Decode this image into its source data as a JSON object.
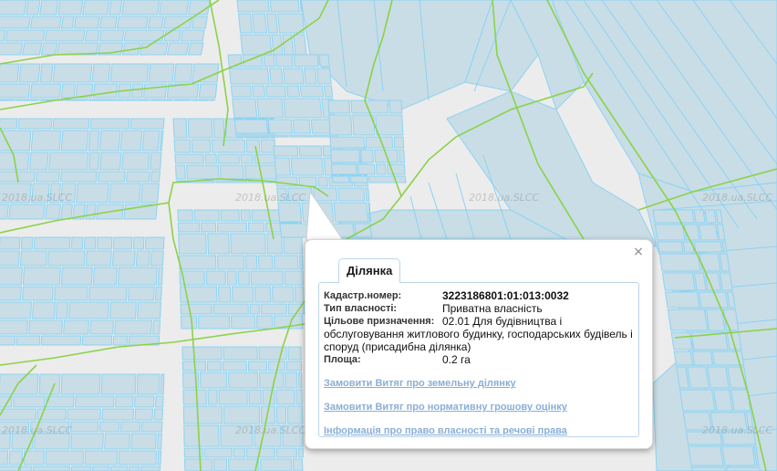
{
  "map": {
    "watermark_text": "2018.ua.SLCC",
    "parcel_color": "#8cd3f2",
    "parcel_fill": "#c9dde6",
    "boundary_color": "#8bd249"
  },
  "popup": {
    "close_icon": "close-icon",
    "close_glyph": "×",
    "tab_title": "Ділянка",
    "fields": {
      "cadastral_label": "Кадастр.номер:",
      "cadastral_value": "3223186801:01:013:0032",
      "ownership_label": "Тип власності:",
      "ownership_value": "Приватна власність",
      "purpose_label": "Цільове призначення:",
      "purpose_line1": "02.01 Для будівництва і",
      "purpose_line2": "обслуговування житлового будинку, господарських будівель і",
      "purpose_line3": "споруд (присадибна ділянка)",
      "area_label": "Площа:",
      "area_value": "0.2 га"
    },
    "links": {
      "extract_parcel": "Замовити Витяг про земельну ділянку",
      "extract_valuation": "Замовити Витяг про нормативну грошову оцінку",
      "ownership_info": "Інформація про право власності та речові права"
    }
  }
}
